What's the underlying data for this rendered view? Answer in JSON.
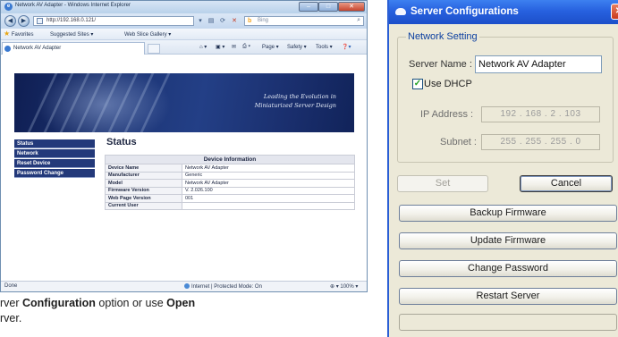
{
  "ie": {
    "window_title": "Network AV Adapter - Windows Internet Explorer",
    "url": "http://192.168.0.121/",
    "search_placeholder": "Bing",
    "favorites_label": "Favorites",
    "suggested_sites_label": "Suggested Sites ▾",
    "web_slice_label": "Web Slice Gallery ▾",
    "tab_label": "Network AV Adapter",
    "command_items": [
      "Page ▾",
      "Safety ▾",
      "Tools ▾"
    ],
    "status_left": "Done",
    "status_zone": "Internet | Protected Mode: On",
    "zoom": "100%"
  },
  "site": {
    "banner_line1": "Leading the Evolution in",
    "banner_line2": "Miniaturized Server Design",
    "nav": [
      "Status",
      "Network",
      "Reset Device",
      "Password Change"
    ],
    "heading": "Status",
    "table_header": "Device Information",
    "rows": [
      {
        "label": "Device Name",
        "value": "Network AV Adapter"
      },
      {
        "label": "Manufacturer",
        "value": "Generic"
      },
      {
        "label": "Model",
        "value": "Network AV Adapter"
      },
      {
        "label": "Firmware Version",
        "value": "V. 2.026.100"
      },
      {
        "label": "Web Page Version",
        "value": "001"
      },
      {
        "label": "Current User",
        "value": ""
      }
    ]
  },
  "caption": {
    "prefix": "rver ",
    "bold1": "Configuration",
    "middle": " option or use ",
    "bold2": "Open",
    "line2": "rver."
  },
  "dialog": {
    "title": "Server Configurations",
    "group_label": "Network Setting",
    "server_name_label": "Server Name :",
    "server_name_value": "Network AV Adapter",
    "dhcp_label": "Use DHCP",
    "dhcp_checked": true,
    "ip_label": "IP Address :",
    "ip_value": "192 . 168 . 2 . 103",
    "subnet_label": "Subnet :",
    "subnet_value": "255 . 255 . 255 . 0",
    "set_label": "Set",
    "cancel_label": "Cancel",
    "backup_label": "Backup Firmware",
    "update_label": "Update Firmware",
    "password_label": "Change Password",
    "restart_label": "Restart Server"
  }
}
